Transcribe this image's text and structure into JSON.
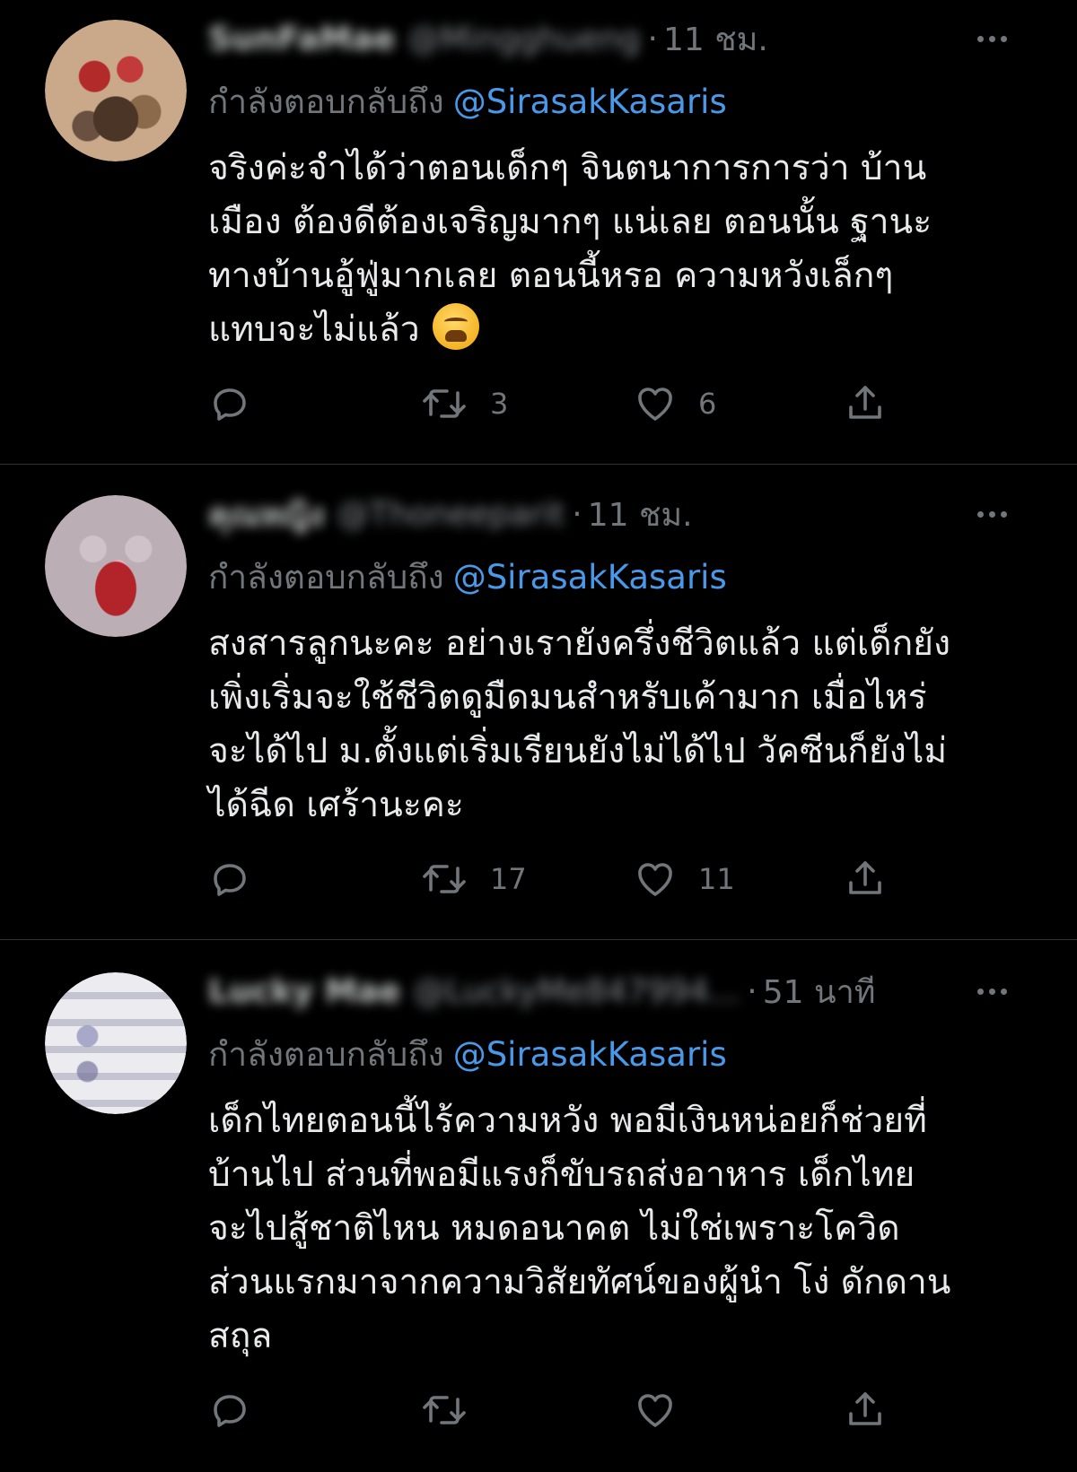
{
  "colors": {
    "background": "#000000",
    "text": "#e7e9ea",
    "muted": "#71767b",
    "mention": "#4a99e9",
    "divider": "#2f3336"
  },
  "tweets": [
    {
      "display_name": "SunFaMae",
      "handle": "@Mingghueng",
      "time": "11 ชม.",
      "replying_prefix": "กำลังตอบกลับถึง",
      "replying_to": "@SirasakKasaris",
      "text_lines": [
        "จริงค่ะจำได้ว่าตอนเด็กๆ จินตนาการการว่า บ้าน",
        "เมือง ต้องดีต้องเจริญมากๆ แน่เลย ตอนนั้น ฐานะ",
        "ทางบ้านอู้ฟู่มากเลย ตอนนี้หรอ ความหวังเล็กๆ",
        "แทบจะไม่แล้ว"
      ],
      "emoji_icon": "weary-face-emoji",
      "retweets": "3",
      "likes": "6"
    },
    {
      "display_name": "คุณหญิง",
      "handle": "@Thoneeparit",
      "time": "11 ชม.",
      "replying_prefix": "กำลังตอบกลับถึง",
      "replying_to": "@SirasakKasaris",
      "text_lines": [
        "สงสารลูกนะคะ อย่างเรายังครึ่งชีวิตแล้ว แต่เด็กยัง",
        "เพิ่งเริ่มจะใช้ชีวิตดูมืดมนสำหรับเค้ามาก เมื่อไหร่",
        "จะได้ไป ม.ตั้งแต่เริ่มเรียนยังไม่ได้ไป วัคซีนก็ยังไม่",
        "ได้ฉีด เศร้านะคะ"
      ],
      "retweets": "17",
      "likes": "11"
    },
    {
      "display_name": "Lucky Mae",
      "handle": "@LuckyMe847994...",
      "time": "51 นาที",
      "replying_prefix": "กำลังตอบกลับถึง",
      "replying_to": "@SirasakKasaris",
      "text_lines": [
        "เด็กไทยตอนนี้ไร้ความหวัง พอมีเงินหน่อยก็ช่วยที่",
        "บ้านไป ส่วนที่พอมีแรงก็ขับรถส่งอาหาร เด็กไทย",
        "จะไปสู้ชาติไหน หมดอนาคต ไม่ใช่เพราะโควิด",
        "ส่วนแรกมาจากความวิสัยทัศน์ของผู้นำ โง่ ดักดาน",
        "สถุล"
      ],
      "retweets": "",
      "likes": ""
    }
  ],
  "icons": {
    "reply": "reply-bubble-icon",
    "retweet": "retweet-icon",
    "like": "heart-icon",
    "share": "share-icon",
    "more": "more-dots-icon"
  }
}
